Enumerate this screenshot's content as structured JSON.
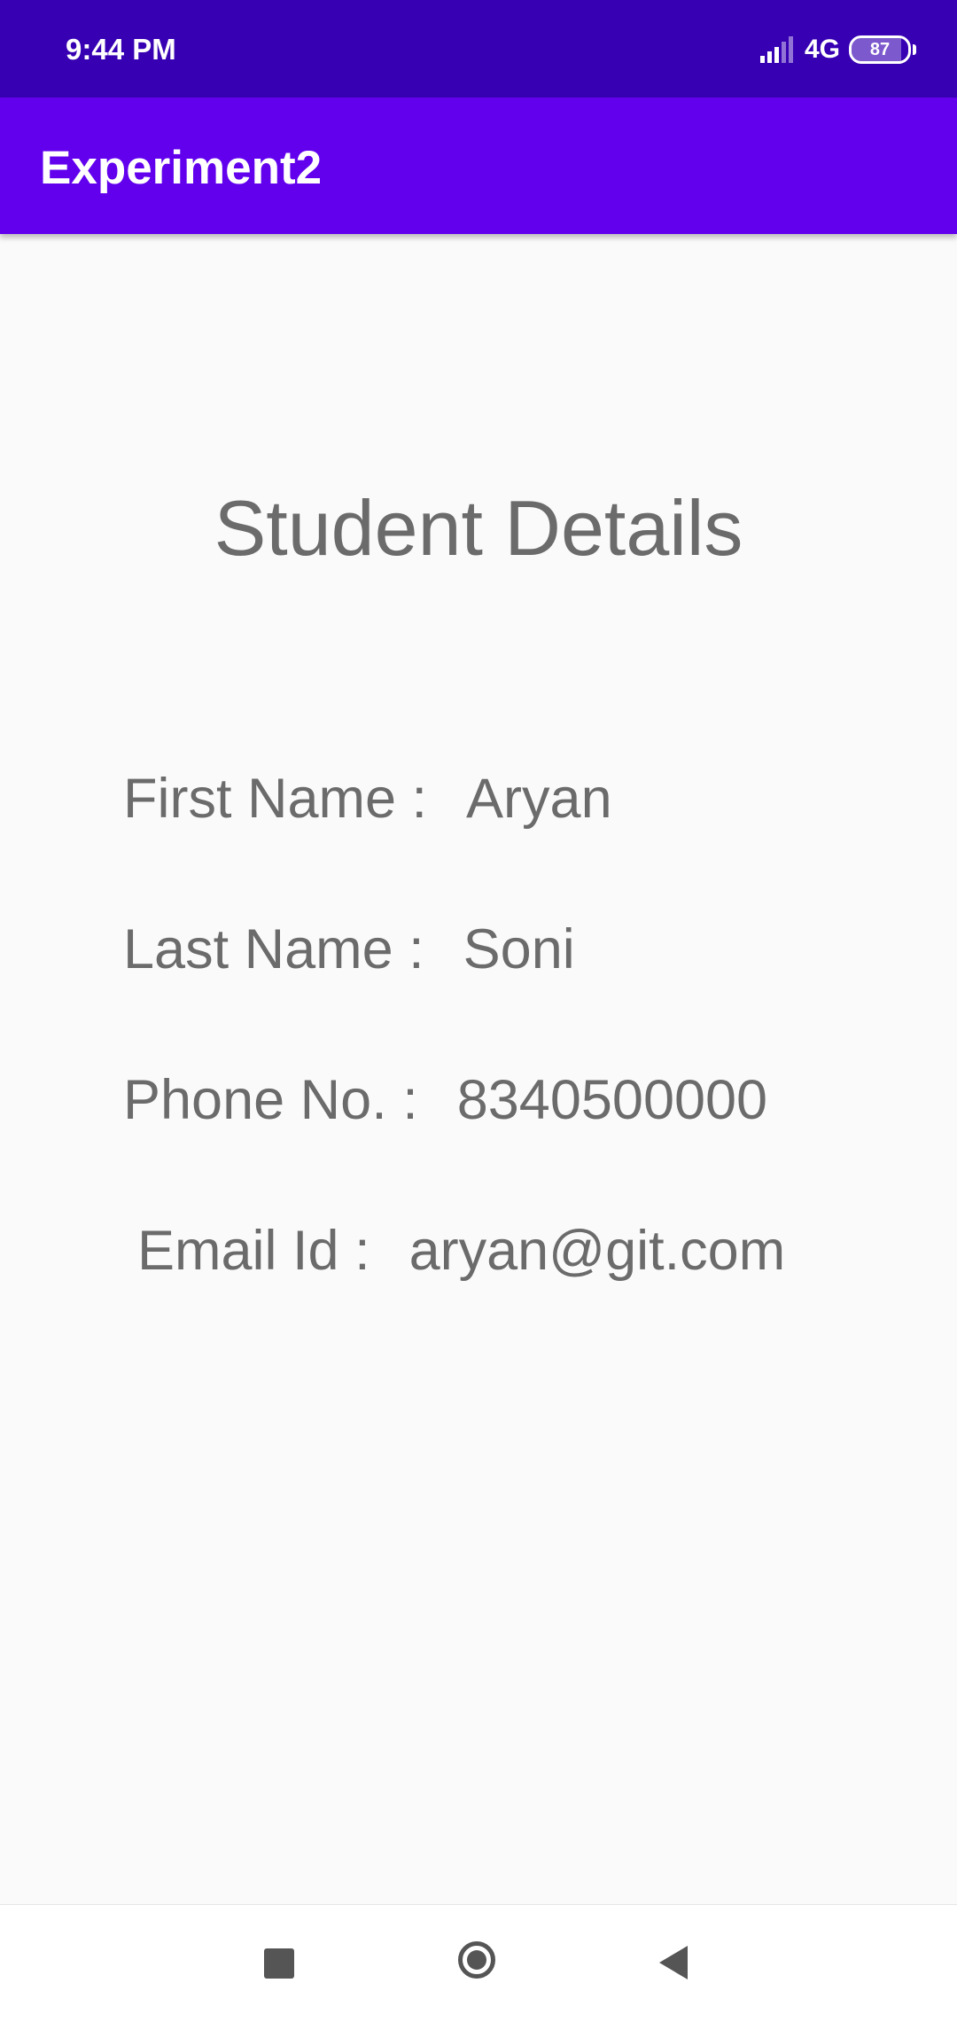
{
  "status_bar": {
    "time": "9:44 PM",
    "network": "4G",
    "battery": "87",
    "battery_level": 0.87,
    "signal_icon": "signal-bars-icon",
    "battery_icon": "battery-icon"
  },
  "app_bar": {
    "title": "Experiment2",
    "color": "#6200ee",
    "status_color": "#3700b3"
  },
  "main": {
    "heading": "Student Details",
    "fields": [
      {
        "label": "First Name :",
        "value": "Aryan"
      },
      {
        "label": "Last Name :",
        "value": "Soni"
      },
      {
        "label": "Phone No. :",
        "value": "8340500000"
      },
      {
        "label": "Email Id :",
        "value": "aryan@git.com"
      }
    ]
  },
  "nav_bar": {
    "recents_icon": "square-recents-icon",
    "home_icon": "circle-home-icon",
    "back_icon": "triangle-back-icon"
  }
}
